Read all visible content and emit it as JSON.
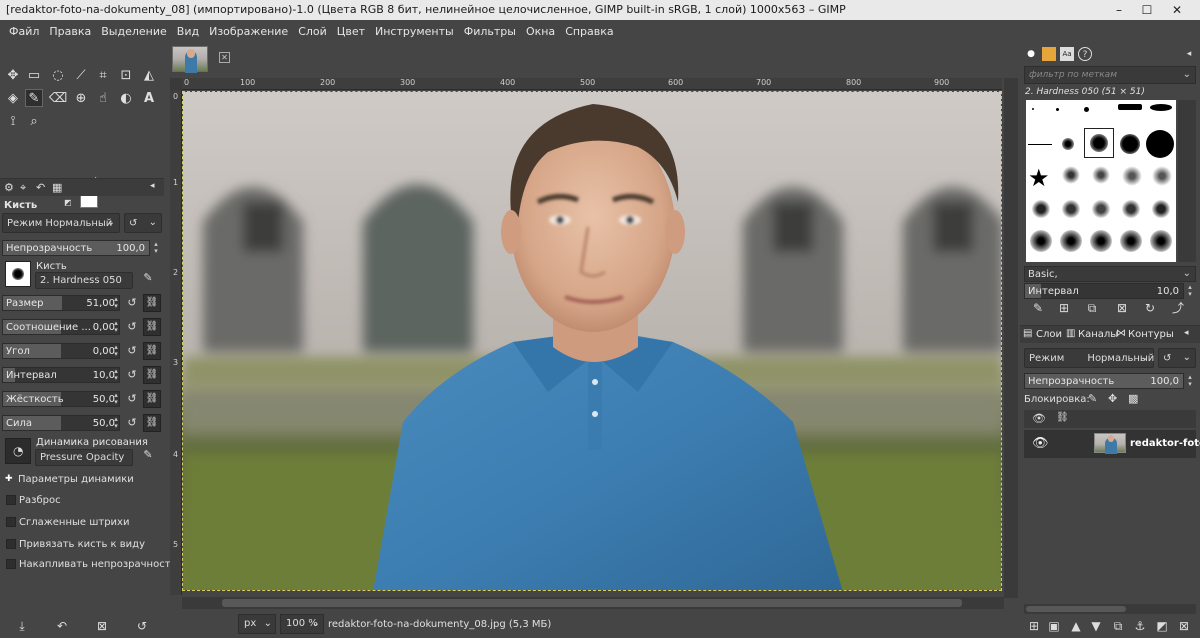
{
  "window": {
    "title": "[redaktor-foto-na-dokumenty_08] (импортировано)-1.0 (Цвета RGB 8 бит, нелинейное целочисленное, GIMP built-in sRGB, 1 слой) 1000x563 – GIMP",
    "minimize": "–",
    "maximize": "☐",
    "close": "✕"
  },
  "menu": [
    "Файл",
    "Правка",
    "Выделение",
    "Вид",
    "Изображение",
    "Слой",
    "Цвет",
    "Инструменты",
    "Фильтры",
    "Окна",
    "Справка"
  ],
  "toolbox": {
    "tools": [
      "move-icon",
      "rect-select-icon",
      "lasso-icon",
      "fuzzy-select-icon",
      "crop-icon",
      "transform-icon",
      "warp-icon",
      "bucket-fill-icon",
      "paintbrush-icon",
      "eraser-icon",
      "clone-icon",
      "smudge-icon",
      "dodge-icon",
      "text-icon",
      "color-picker-icon",
      "zoom-icon"
    ],
    "fg_color": "#000000",
    "bg_color": "#ffffff"
  },
  "tool_options": {
    "header": "Кисть",
    "mode_label": "Режим",
    "mode_value": "Нормальный",
    "opacity": {
      "label": "Непрозрачность",
      "value": "100,0"
    },
    "brush": {
      "label": "Кисть",
      "value": "2. Hardness 050"
    },
    "sliders": [
      {
        "label": "Размер",
        "value": "51,00",
        "fill": 0.51
      },
      {
        "label": "Соотношение ...",
        "value": "0,00",
        "fill": 0.5
      },
      {
        "label": "Угол",
        "value": "0,00",
        "fill": 0.5
      },
      {
        "label": "Интервал",
        "value": "10,0",
        "fill": 0.1
      },
      {
        "label": "Жёсткость",
        "value": "50,0",
        "fill": 0.5
      },
      {
        "label": "Сила",
        "value": "50,0",
        "fill": 0.5
      }
    ],
    "dynamics": {
      "label": "Динамика рисования",
      "value": "Pressure Opacity"
    },
    "dynamics_params": "Параметры динамики",
    "checkboxes": [
      "Разброс",
      "Сглаженные штрихи",
      "Привязать кисть к виду",
      "Накапливать непрозрачность"
    ]
  },
  "image_tab": {
    "close": "✕"
  },
  "ruler": {
    "top_ticks": [
      "0",
      "100",
      "200",
      "300",
      "400",
      "500",
      "600",
      "700",
      "800",
      "900"
    ],
    "left_ticks": [
      "0",
      "1",
      "2",
      "3",
      "4",
      "5"
    ]
  },
  "status": {
    "unit": "px",
    "zoom": "100 %",
    "file": "redaktor-foto-na-dokumenty_08.jpg (5,3 МБ)"
  },
  "brushes_panel": {
    "filter_placeholder": "фильтр по меткам",
    "selected": "2. Hardness 050 (51 × 51)",
    "preset": "Basic,",
    "spacing": {
      "label": "Интервал",
      "value": "10,0"
    }
  },
  "layers_panel": {
    "tabs": [
      "Слои",
      "Каналы",
      "Контуры"
    ],
    "mode_label": "Режим",
    "mode_value": "Нормальный",
    "opacity": {
      "label": "Непрозрачность",
      "value": "100,0"
    },
    "lock_label": "Блокировка:",
    "layer_name": "redaktor-foto-"
  }
}
